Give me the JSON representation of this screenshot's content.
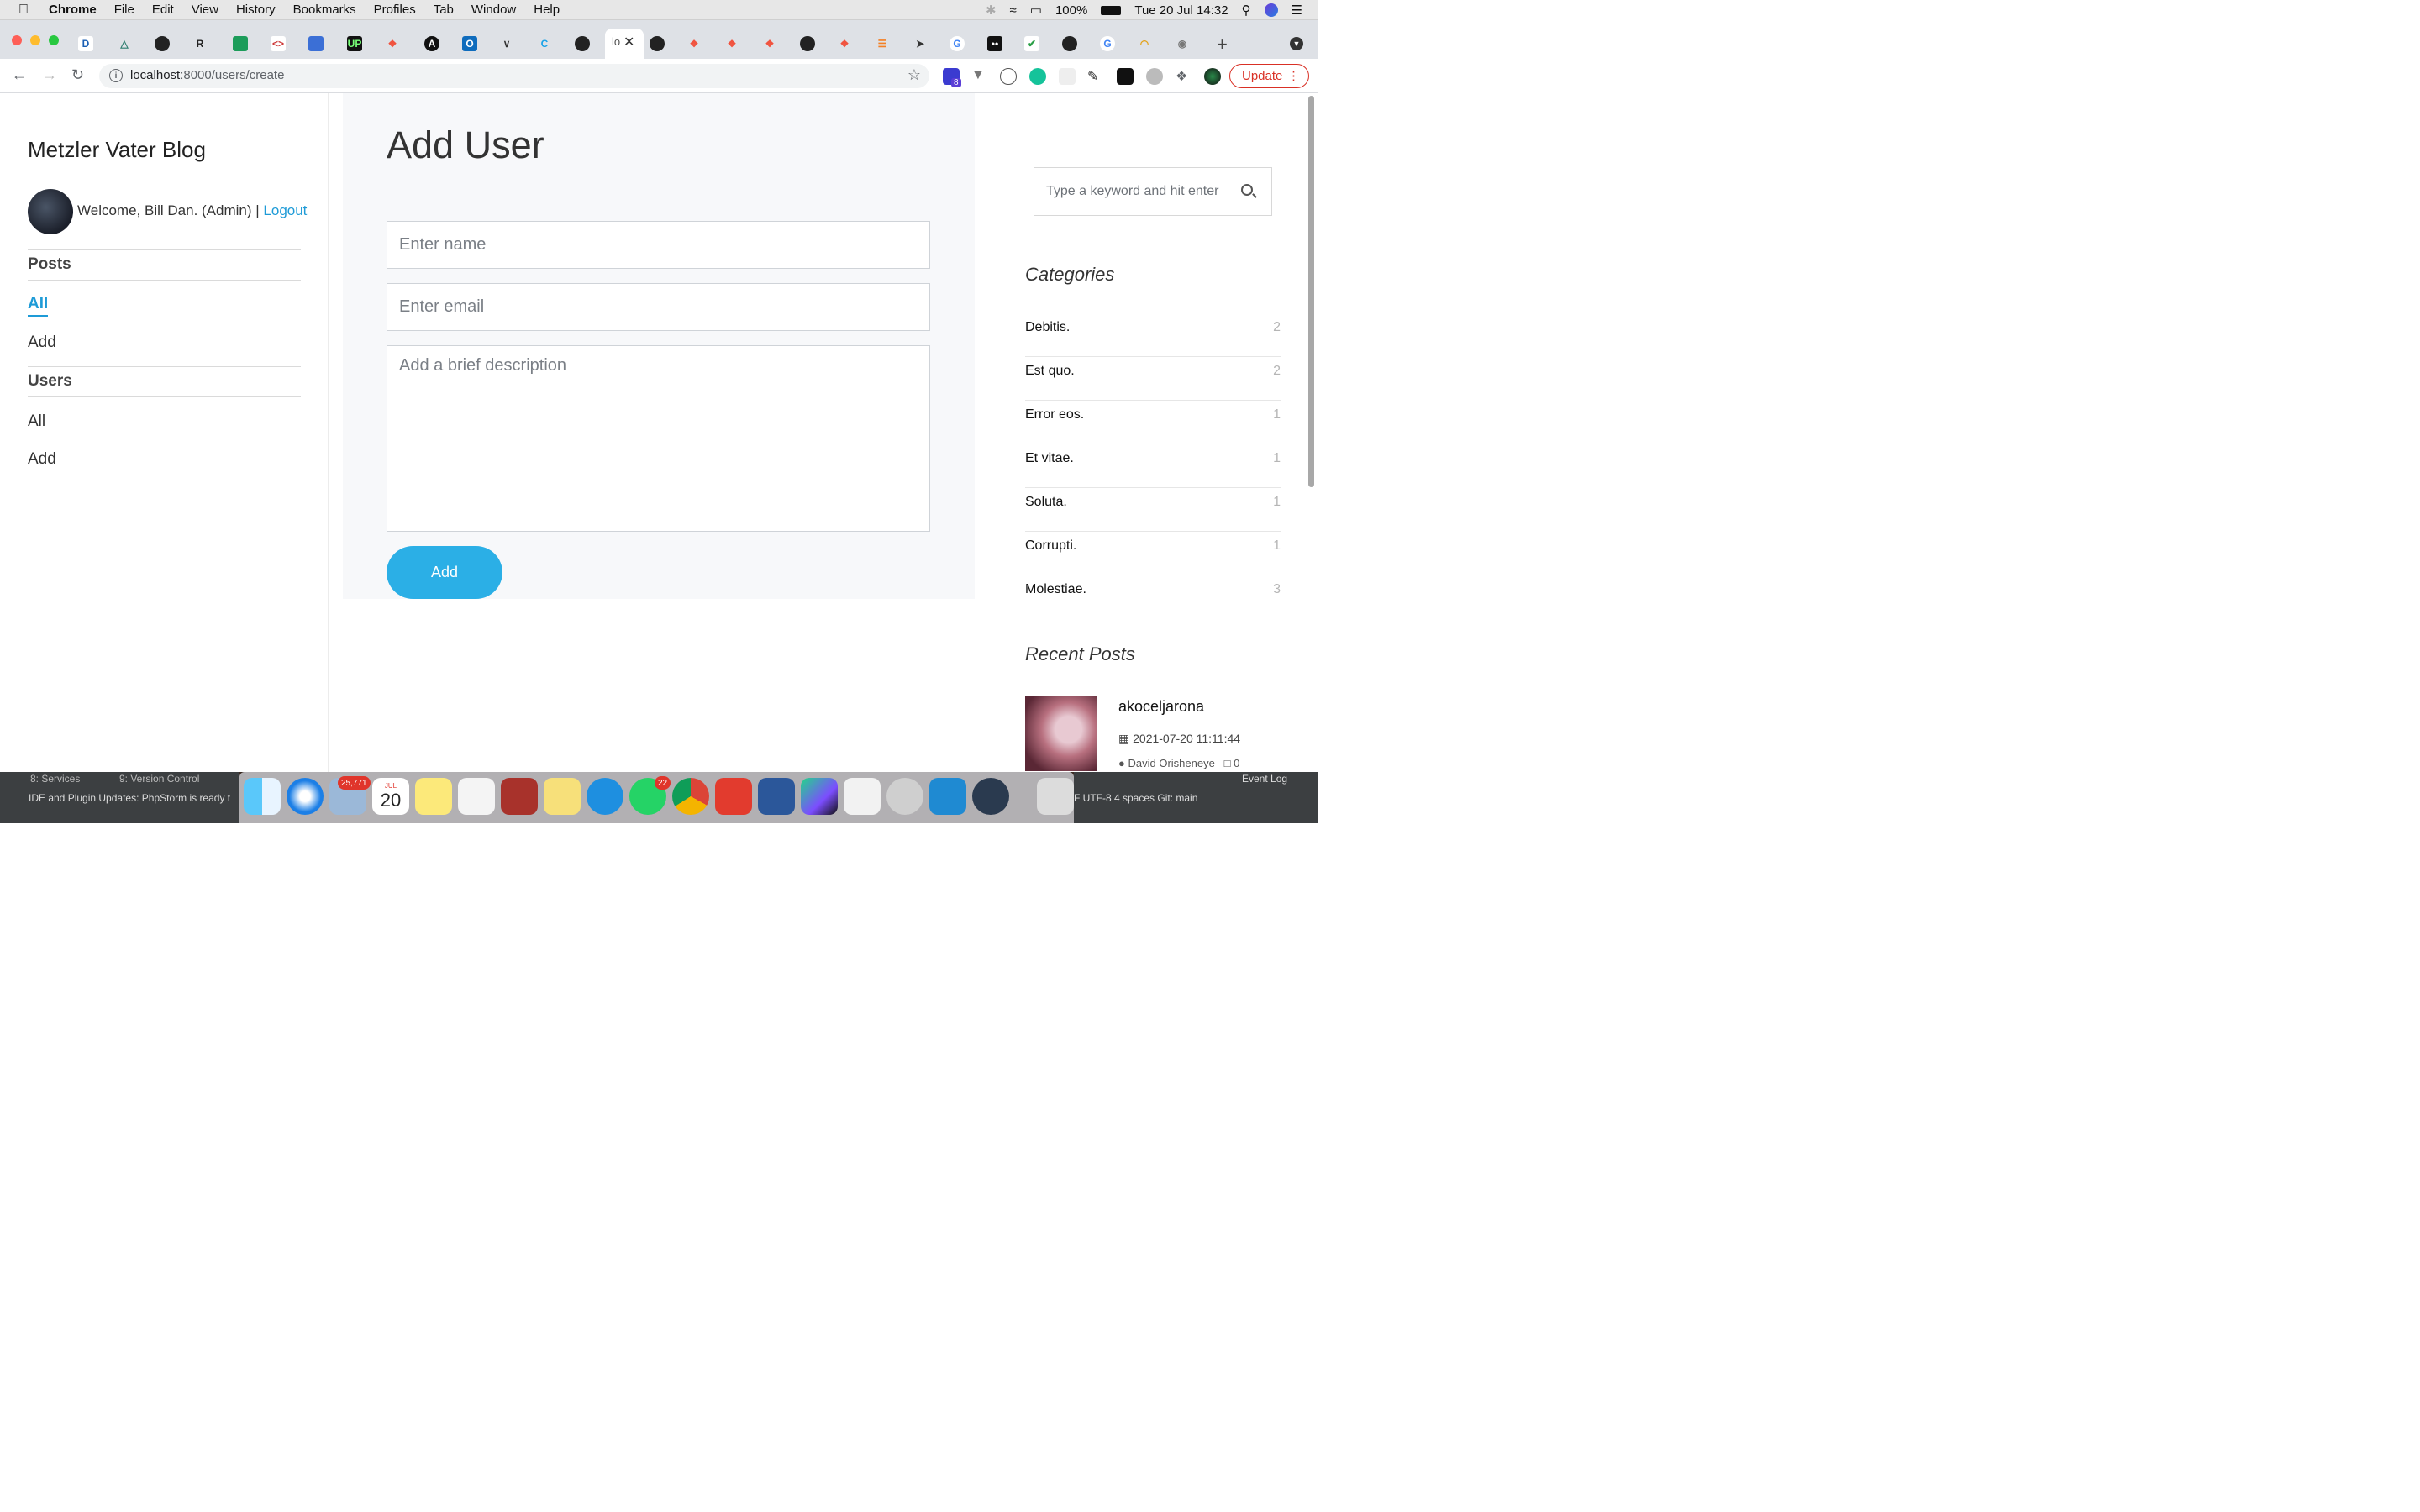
{
  "menubar": {
    "items": [
      "Chrome",
      "File",
      "Edit",
      "View",
      "History",
      "Bookmarks",
      "Profiles",
      "Tab",
      "Window",
      "Help"
    ],
    "battery": "100%",
    "datetime": "Tue 20 Jul  14:32"
  },
  "browser": {
    "active_tab_label": "lo",
    "url_host": "localhost",
    "url_rest": ":8000/users/create",
    "update_label": "Update",
    "extension_badge": "8"
  },
  "sidebar": {
    "blog_title": "Metzler Vater Blog",
    "welcome_text": "Welcome, Bill Dan. (Admin) |",
    "logout_label": "Logout",
    "posts_heading": "Posts",
    "posts_links": [
      "All",
      "Add"
    ],
    "users_heading": "Users",
    "users_links": [
      "All",
      "Add"
    ]
  },
  "form": {
    "title": "Add User",
    "name_placeholder": "Enter name",
    "email_placeholder": "Enter email",
    "description_placeholder": "Add a brief description",
    "submit_label": "Add"
  },
  "right": {
    "search_placeholder": "Type a keyword and hit enter",
    "categories_heading": "Categories",
    "categories": [
      {
        "name": "Debitis.",
        "count": "2"
      },
      {
        "name": "Est quo.",
        "count": "2"
      },
      {
        "name": "Error eos.",
        "count": "1"
      },
      {
        "name": "Et vitae.",
        "count": "1"
      },
      {
        "name": "Soluta.",
        "count": "1"
      },
      {
        "name": "Corrupti.",
        "count": "1"
      },
      {
        "name": "Molestiae.",
        "count": "3"
      }
    ],
    "recent_heading": "Recent Posts",
    "recent_post": {
      "title": "akoceljarona",
      "date": "2021-07-20 11:11:44",
      "author": "David Orisheneye",
      "comments": "0"
    }
  },
  "ide": {
    "services": "8: Services",
    "vcs": "9: Version Control",
    "notice": "IDE and Plugin Updates: PhpStorm is ready t",
    "event_log": "Event Log",
    "status": "F   UTF-8   4 spaces   Git: main"
  },
  "dock": {
    "mail_badge": "25,771",
    "whatsapp_badge": "22",
    "calendar_month": "JUL",
    "calendar_day": "20"
  },
  "colors": {
    "accent": "#2bafe6",
    "link": "#1e9bd7",
    "update_red": "#d93025"
  }
}
